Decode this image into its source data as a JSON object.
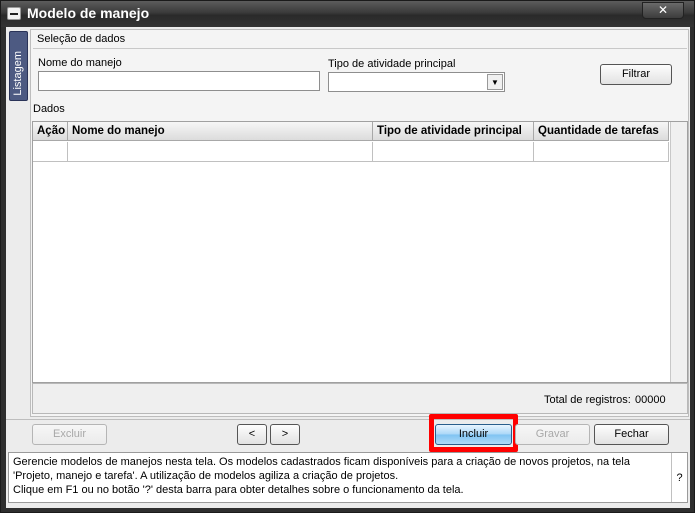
{
  "window": {
    "title": "Modelo de manejo",
    "close_glyph": "✕"
  },
  "side_tab": {
    "label": "Listagem"
  },
  "selecao": {
    "section_label": "Seleção de dados",
    "nome_label": "Nome do manejo",
    "nome_value": "",
    "tipo_label": "Tipo de atividade principal",
    "tipo_value": "",
    "filtrar_label": "Filtrar"
  },
  "dados": {
    "section_label": "Dados",
    "columns": [
      "Ação",
      "Nome do manejo",
      "Tipo de atividade principal",
      "Quantidade de tarefas"
    ],
    "rows": [
      [
        "",
        "",
        "",
        ""
      ]
    ],
    "total_label": "Total de registros:",
    "total_value": "00000"
  },
  "buttons": {
    "excluir": "Excluir",
    "prev": "<",
    "next": ">",
    "incluir": "Incluir",
    "gravar": "Gravar",
    "fechar": "Fechar"
  },
  "help": {
    "line1": "Gerencie modelos de manejos nesta tela. Os modelos cadastrados ficam disponíveis para a criação de novos projetos, na tela",
    "line2": "'Projeto, manejo e tarefa'. A utilização de modelos agiliza a criação de projetos.",
    "line3": "Clique em F1 ou no botão '?' desta barra para obter detalhes sobre o funcionamento da tela.",
    "question": "?"
  },
  "colors": {
    "title_bar": "#333333",
    "side_tab": "#4d5a82",
    "highlight": "#ff0000",
    "primary_button": "#7fc3f2"
  }
}
